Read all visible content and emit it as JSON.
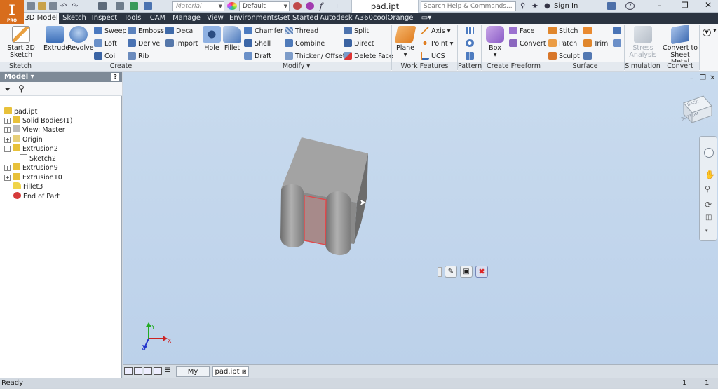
{
  "app": {
    "logo": "I",
    "edition": "PRO"
  },
  "qat": {
    "material_placeholder": "Material",
    "appearance_value": "Default",
    "doc_title": "pad.ipt",
    "search_placeholder": "Search Help & Commands...",
    "sign_in": "Sign In"
  },
  "tabs": [
    "3D Model",
    "Sketch",
    "Inspect",
    "Tools",
    "CAM",
    "Manage",
    "View",
    "Environments",
    "Get Started",
    "Autodesk A360",
    "coolOrange"
  ],
  "ribbon": {
    "start_sketch": "Start 2D Sketch",
    "extrude": "Extrude",
    "revolve": "Revolve",
    "sweep": "Sweep",
    "loft": "Loft",
    "coil": "Coil",
    "emboss": "Emboss",
    "derive": "Derive",
    "rib": "Rib",
    "decal": "Decal",
    "import": "Import",
    "hole": "Hole",
    "fillet": "Fillet",
    "chamfer": "Chamfer",
    "shell": "Shell",
    "draft": "Draft",
    "thread": "Thread",
    "combine": "Combine",
    "thicken": "Thicken/ Offset",
    "split": "Split",
    "direct": "Direct",
    "delete_face": "Delete Face",
    "plane": "Plane",
    "axis": "Axis",
    "point": "Point",
    "ucs": "UCS",
    "box": "Box",
    "face": "Face",
    "convert": "Convert",
    "stitch": "Stitch",
    "patch": "Patch",
    "sculpt": "Sculpt",
    "trim": "Trim",
    "stress_analysis": "Stress Analysis",
    "convert_sheet_metal": "Convert to Sheet Metal",
    "groups": [
      "Sketch",
      "Create",
      "Modify",
      "Work Features",
      "Pattern",
      "Create Freeform",
      "Surface",
      "Simulation",
      "Convert"
    ]
  },
  "panel": {
    "title": "Model",
    "help": "?",
    "tree": [
      "pad.ipt",
      "Solid Bodies(1)",
      "View: Master",
      "Origin",
      "Extrusion2",
      "Sketch2",
      "Extrusion9",
      "Extrusion10",
      "Fillet3",
      "End of Part"
    ]
  },
  "viewcube": {
    "back": "BACK",
    "bottom": "BOTTOM"
  },
  "triad": {
    "x": "X",
    "y": "Y",
    "z": "Z"
  },
  "doctabs": {
    "home": "My Home",
    "file": "pad.ipt"
  },
  "status": {
    "text": "Ready",
    "count1": "1",
    "count2": "1"
  },
  "colors": {
    "accent": "#d86d1c",
    "tab_bar": "#2b3441",
    "viewport": "#c2d6ec",
    "selection": "#e2474a"
  }
}
